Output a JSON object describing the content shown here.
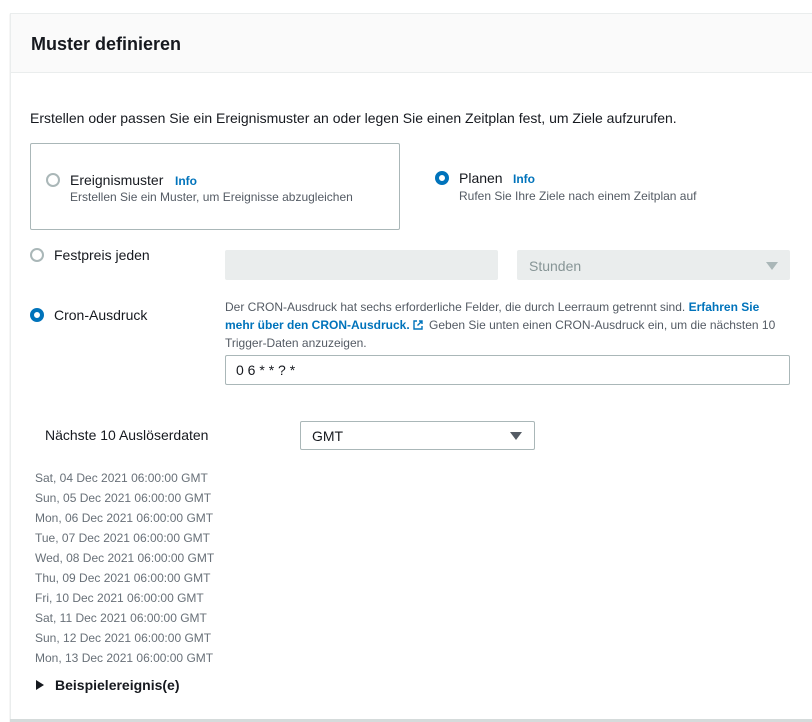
{
  "panel": {
    "title": "Muster definieren",
    "description": "Erstellen oder passen Sie ein Ereignismuster an oder legen Sie einen Zeitplan fest, um Ziele aufzurufen."
  },
  "pattern_options": [
    {
      "label": "Ereignismuster",
      "info": "Info",
      "description": "Erstellen Sie ein Muster, um Ereignisse abzugleichen",
      "checked": false
    },
    {
      "label": "Planen",
      "info": "Info",
      "description": "Rufen Sie Ihre Ziele nach einem Zeitplan auf",
      "checked": true
    }
  ],
  "schedule": {
    "fixed_rate": {
      "label": "Festpreis jeden",
      "value": "",
      "unit": "Stunden",
      "checked": false
    },
    "cron": {
      "label": "Cron-Ausdruck",
      "checked": true,
      "help_prefix": "Der CRON-Ausdruck hat sechs erforderliche Felder, die durch Leerraum getrennt sind.",
      "help_link": "Erfahren Sie mehr über den CRON-Ausdruck.",
      "help_suffix": "Geben Sie unten einen CRON-Ausdruck ein, um die nächsten 10 Trigger-Daten anzuzeigen.",
      "value": "0 6 * * ? *"
    }
  },
  "trigger_dates": {
    "label": "Nächste 10 Auslöserdaten",
    "timezone": "GMT",
    "dates": [
      "Sat, 04 Dec 2021 06:00:00 GMT",
      "Sun, 05 Dec 2021 06:00:00 GMT",
      "Mon, 06 Dec 2021 06:00:00 GMT",
      "Tue, 07 Dec 2021 06:00:00 GMT",
      "Wed, 08 Dec 2021 06:00:00 GMT",
      "Thu, 09 Dec 2021 06:00:00 GMT",
      "Fri, 10 Dec 2021 06:00:00 GMT",
      "Sat, 11 Dec 2021 06:00:00 GMT",
      "Sun, 12 Dec 2021 06:00:00 GMT",
      "Mon, 13 Dec 2021 06:00:00 GMT"
    ]
  },
  "sample_event": {
    "label": "Beispielereignis(e)"
  },
  "colors": {
    "accent": "#0073bb",
    "border": "#aab7b8",
    "muted_text": "#687078"
  }
}
